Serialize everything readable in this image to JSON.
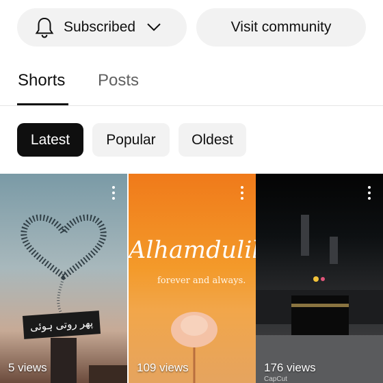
{
  "header": {
    "subscribed_label": "Subscribed",
    "visit_label": "Visit community"
  },
  "tabs": [
    {
      "label": "Shorts",
      "active": true
    },
    {
      "label": "Posts",
      "active": false
    }
  ],
  "filters": [
    {
      "label": "Latest",
      "active": true
    },
    {
      "label": "Popular",
      "active": false
    },
    {
      "label": "Oldest",
      "active": false
    }
  ],
  "shorts": [
    {
      "views": "5 views",
      "overlay_text": "پھر روتی ہوئی"
    },
    {
      "views": "109 views",
      "title_text": "Alhamdulillah",
      "subtitle_text": "forever and always."
    },
    {
      "views": "176 views",
      "watermark": "CapCut"
    }
  ],
  "icons": {
    "bell": "bell-icon",
    "chevron": "chevron-down-icon",
    "more": "more-vert-icon"
  }
}
